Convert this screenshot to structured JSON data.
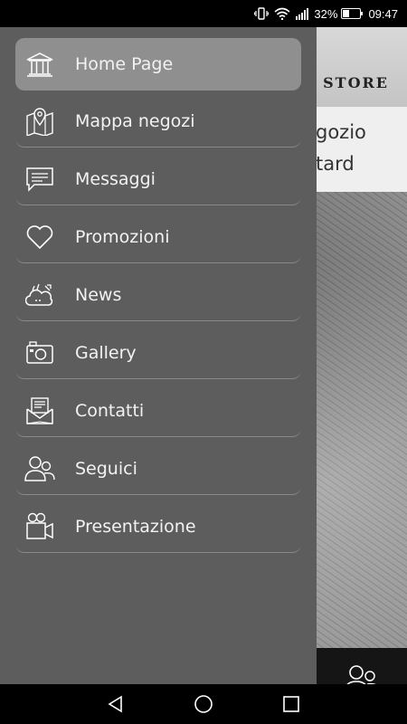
{
  "status_bar": {
    "battery_percent": "32%",
    "time": "09:47",
    "icons": [
      "vibrate-icon",
      "wifi-icon",
      "signal-icon",
      "battery-icon"
    ]
  },
  "background": {
    "store_logo": "STORE",
    "info_line1": "gozio",
    "info_line2": "tard"
  },
  "drawer": {
    "items": [
      {
        "label": "Home Page",
        "icon": "bank-building-icon",
        "active": true
      },
      {
        "label": "Mappa negozi",
        "icon": "map-pin-icon",
        "active": false
      },
      {
        "label": "Messaggi",
        "icon": "message-icon",
        "active": false
      },
      {
        "label": "Promozioni",
        "icon": "heart-icon",
        "active": false
      },
      {
        "label": "News",
        "icon": "cloud-news-icon",
        "active": false
      },
      {
        "label": "Gallery",
        "icon": "camera-icon",
        "active": false
      },
      {
        "label": "Contatti",
        "icon": "mail-icon",
        "active": false
      },
      {
        "label": "Seguici",
        "icon": "users-icon",
        "active": false
      },
      {
        "label": "Presentazione",
        "icon": "video-camera-icon",
        "active": false
      }
    ]
  },
  "nav_bar": {
    "buttons": [
      "back-icon",
      "home-icon",
      "recents-icon"
    ]
  },
  "colors": {
    "drawer_bg": "#5d5d5d",
    "active_item_bg": "#8f8f8f",
    "divider": "#8a8a8a"
  }
}
